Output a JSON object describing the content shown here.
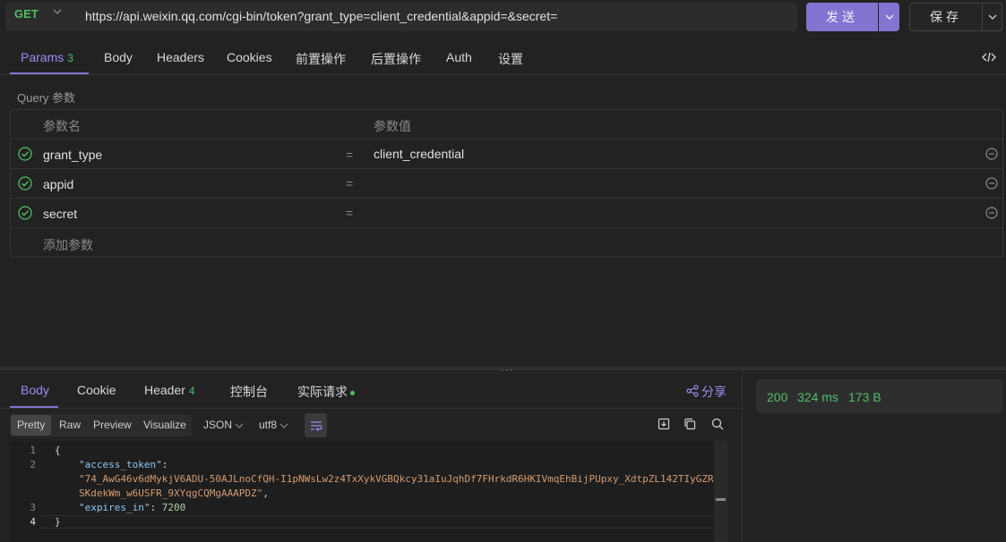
{
  "request": {
    "method": "GET",
    "url": "https://api.weixin.qq.com/cgi-bin/token?grant_type=client_credential&appid=&secret=",
    "send_label": "发送",
    "save_label": "保存"
  },
  "request_tabs": {
    "params": "Params",
    "params_count": "3",
    "body": "Body",
    "headers": "Headers",
    "cookies": "Cookies",
    "pre": "前置操作",
    "post": "后置操作",
    "auth": "Auth",
    "settings": "设置"
  },
  "query": {
    "section_label": "Query 参数",
    "col_name": "参数名",
    "col_value": "参数值",
    "rows": [
      {
        "name": "grant_type",
        "eq": "=",
        "value": "client_credential"
      },
      {
        "name": "appid",
        "eq": "=",
        "value": ""
      },
      {
        "name": "secret",
        "eq": "=",
        "value": ""
      }
    ],
    "add_placeholder": "添加参数"
  },
  "response_tabs": {
    "body": "Body",
    "cookie": "Cookie",
    "header": "Header",
    "header_count": "4",
    "console": "控制台",
    "actual": "实际请求",
    "share": "分享"
  },
  "viewer": {
    "views": [
      "Pretty",
      "Raw",
      "Preview",
      "Visualize"
    ],
    "format": "JSON",
    "encoding": "utf8"
  },
  "code": {
    "line_numbers": [
      "1",
      "2",
      "3",
      "4"
    ],
    "open_brace": "{",
    "key1": "\"access_token\"",
    "colon1": ":",
    "token_part1": "\"74_AwG46v6dMykjV6ADU-50AJLnoCfQH-I1pNWsLw2z4TxXykVGBQkcy31aIuJqhDf7FHrkdR6HKIVmqEhBijPUpxy_XdtpZL142TIyGZR",
    "token_part2": "SKdekWm_w6USFR_9XYqgCQMgAAAPDZ\"",
    "comma": ",",
    "key2": "\"expires_in\"",
    "colon2": ":",
    "value2": "7200",
    "close_brace": "}"
  },
  "status": {
    "code": "200",
    "time": "324 ms",
    "size": "173 B"
  },
  "colors": {
    "accent": "#8474d1",
    "success": "#4fbf66",
    "background": "#222222"
  }
}
